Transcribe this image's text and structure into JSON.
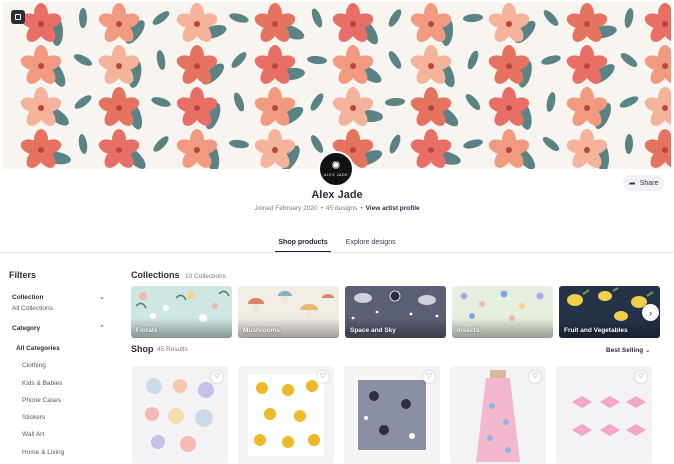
{
  "colors": {
    "accent": "#2b2e44",
    "muted": "#777a88",
    "banner_bg": "#f7f3ee"
  },
  "profile": {
    "avatar_text": "ALEX JADE",
    "name": "Alex Jade",
    "joined": "Joined February 2020",
    "designs": "45 designs",
    "view_profile": "View artist profile",
    "share": "Share"
  },
  "tabs": [
    {
      "label": "Shop products",
      "active": true
    },
    {
      "label": "Explore designs",
      "active": false
    }
  ],
  "filters": {
    "title": "Filters",
    "collection_label": "Collection",
    "collection_value": "All Collections",
    "category_label": "Category",
    "categories": [
      "All Categories",
      "Clothing",
      "Kids & Babies",
      "Phone Cases",
      "Stickers",
      "Wall Art",
      "Home & Living"
    ]
  },
  "collections": {
    "title": "Collections",
    "count": "10 Collections",
    "items": [
      {
        "label": "Florals",
        "icon": "floral-pattern"
      },
      {
        "label": "Mushrooms",
        "icon": "mushroom-pattern"
      },
      {
        "label": "Space and Sky",
        "icon": "space-pattern"
      },
      {
        "label": "Insects",
        "icon": "insect-pattern"
      },
      {
        "label": "Fruit and Vegetables",
        "icon": "lemon-pattern"
      }
    ]
  },
  "shop": {
    "title": "Shop",
    "count": "45 Results",
    "sort": "Best Selling",
    "products": [
      {
        "type": "sticker sheet",
        "icon": "seashell-stickers"
      },
      {
        "type": "fabric print",
        "icon": "sunflower-print"
      },
      {
        "type": "framed print",
        "icon": "space-print"
      },
      {
        "type": "dress",
        "icon": "floral-dress"
      },
      {
        "type": "sticker sheet",
        "icon": "bow-stickers"
      }
    ]
  }
}
